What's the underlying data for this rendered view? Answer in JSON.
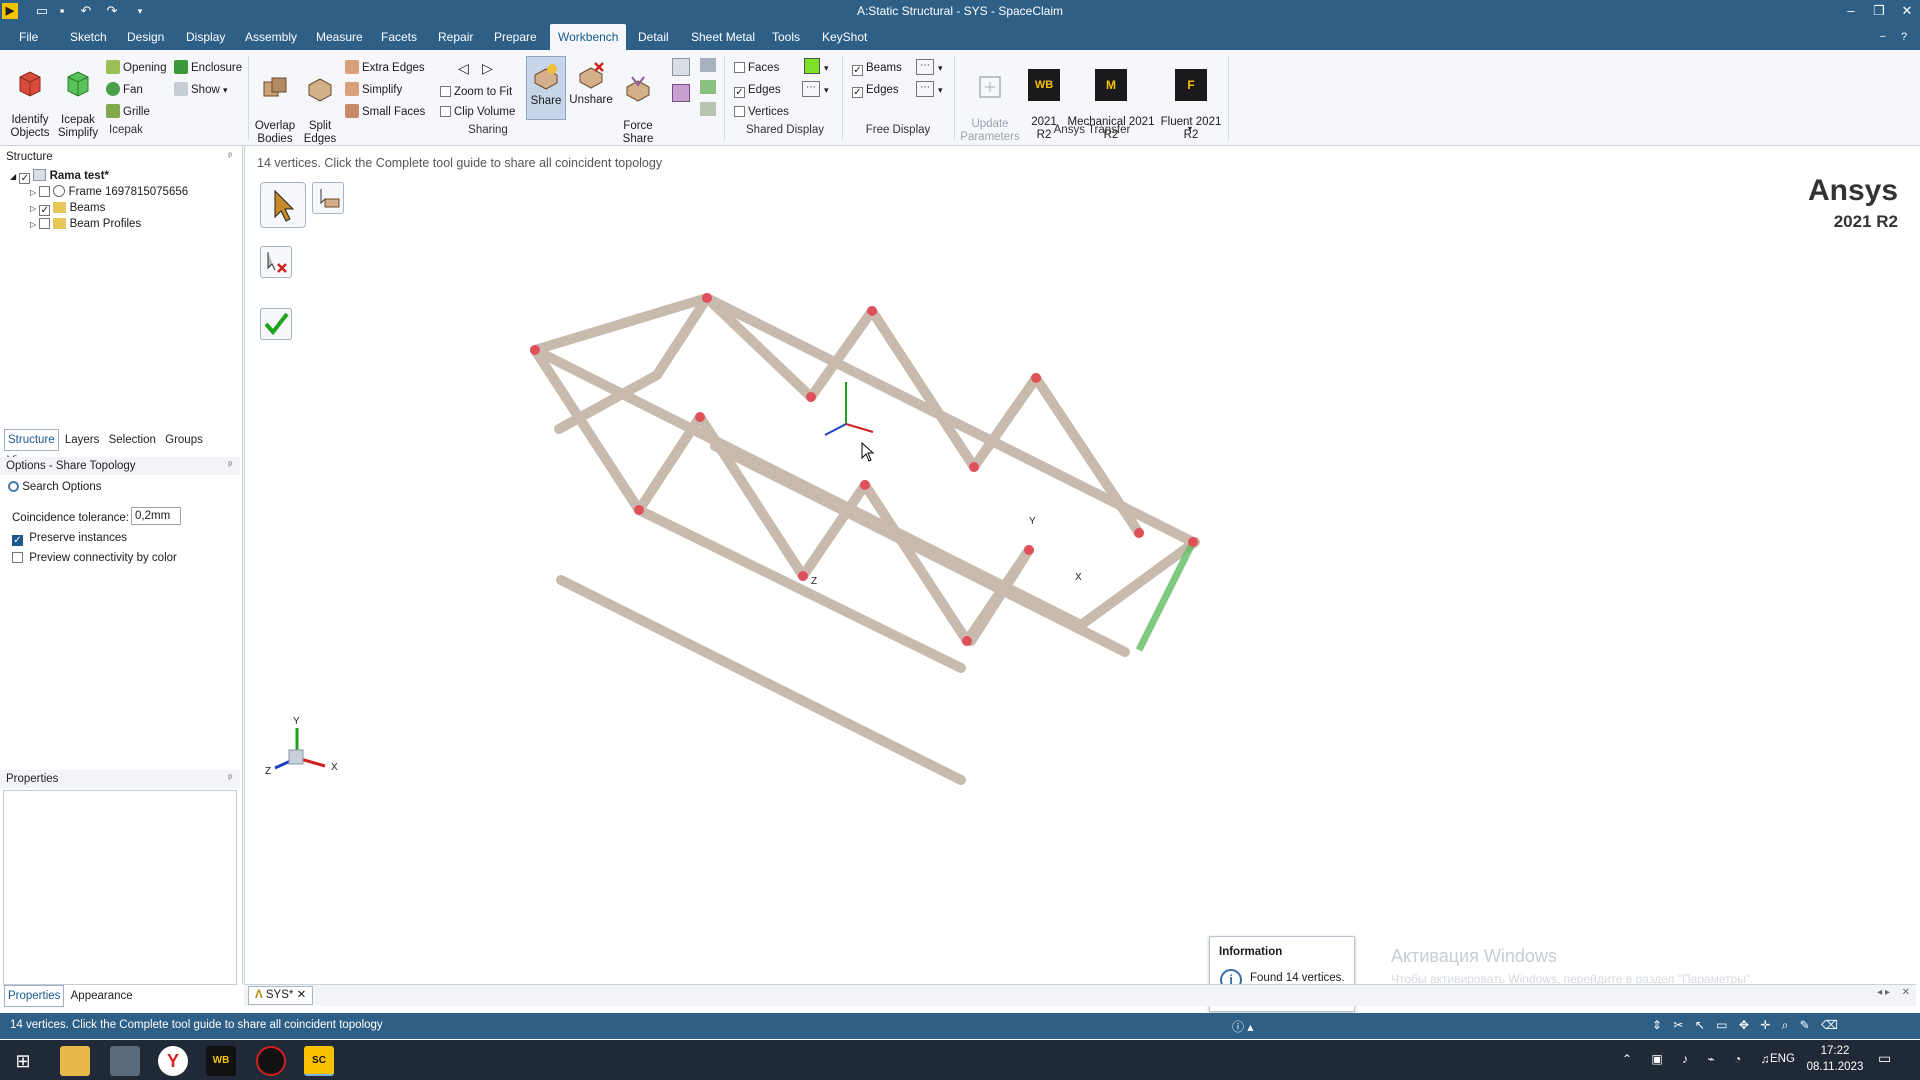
{
  "window": {
    "title": "A:Static Structural - SYS - SpaceClaim"
  },
  "menu": {
    "items": [
      "File",
      "Sketch",
      "Design",
      "Display",
      "Assembly",
      "Measure",
      "Facets",
      "Repair",
      "Prepare",
      "Workbench",
      "Detail",
      "Sheet Metal",
      "Tools",
      "KeyShot"
    ],
    "active": "Workbench"
  },
  "ribbon": {
    "icepak": {
      "identify": "Identify\nObjects",
      "simplify": "Icepak\nSimplify",
      "opening": "Opening",
      "enclosure": "Enclosure",
      "fan": "Fan",
      "show": "Show",
      "grille": "Grille",
      "group": "Icepak"
    },
    "sharing": {
      "overlap": "Overlap\nBodies",
      "split": "Split\nEdges",
      "extra_edges": "Extra Edges",
      "simplify": "Simplify",
      "small_faces": "Small Faces",
      "zoom_to_fit": "Zoom to Fit",
      "clip_volume": "Clip Volume",
      "share": "Share",
      "unshare": "Unshare",
      "force_share": "Force\nShare",
      "group": "Sharing"
    },
    "shared_display": {
      "faces": "Faces",
      "edges": "Edges",
      "vertices": "Vertices",
      "group": "Shared Display",
      "faces_color": "#7fe02a"
    },
    "free_display": {
      "beams": "Beams",
      "edges": "Edges",
      "group": "Free Display"
    },
    "transfer": {
      "update": "Update\nParameters",
      "wb": "2021\nR2",
      "wb_icon": "WB",
      "mech": "Mechanical 2021\nR2",
      "mech_icon": "M",
      "fluent": "Fluent 2021\nR2",
      "fluent_icon": "F",
      "group": "Ansys Transfer"
    }
  },
  "structure": {
    "header": "Structure",
    "root": "Rama test*",
    "items": [
      "Frame 1697815075656",
      "Beams",
      "Beam Profiles"
    ]
  },
  "lefttabs": [
    "Structure",
    "Layers",
    "Selection",
    "Groups",
    "Views"
  ],
  "options": {
    "header": "Options - Share Topology",
    "search": "Search Options",
    "tolerance_label": "Coincidence tolerance:",
    "tolerance_value": "0,2mm",
    "preserve": "Preserve instances",
    "preview": "Preview connectivity by color"
  },
  "properties": {
    "header": "Properties",
    "tabs": [
      "Properties",
      "Appearance"
    ]
  },
  "viewport": {
    "hint": "14 vertices. Click the Complete tool guide to share all coincident topology",
    "brand": "Ansys",
    "version": "2021 R2",
    "doc_tab": "SYS*",
    "axis": {
      "x": "X",
      "y": "Y",
      "z": "Z"
    }
  },
  "info_popup": {
    "title": "Information",
    "message": "Found 14 vertices."
  },
  "watermark": {
    "line1": "Активация Windows",
    "line2": "Чтобы активировать Windows, перейдите в раздел \"Параметры\"."
  },
  "status": {
    "text": "14 vertices. Click the Complete tool guide to share all coincident topology"
  },
  "taskbar": {
    "lang": "ENG",
    "time": "17:22",
    "date": "08.11.2023"
  },
  "colors": {
    "chrome": "#2d5f87",
    "beam": "#c9b9ab",
    "vertex": "#e0505a"
  }
}
